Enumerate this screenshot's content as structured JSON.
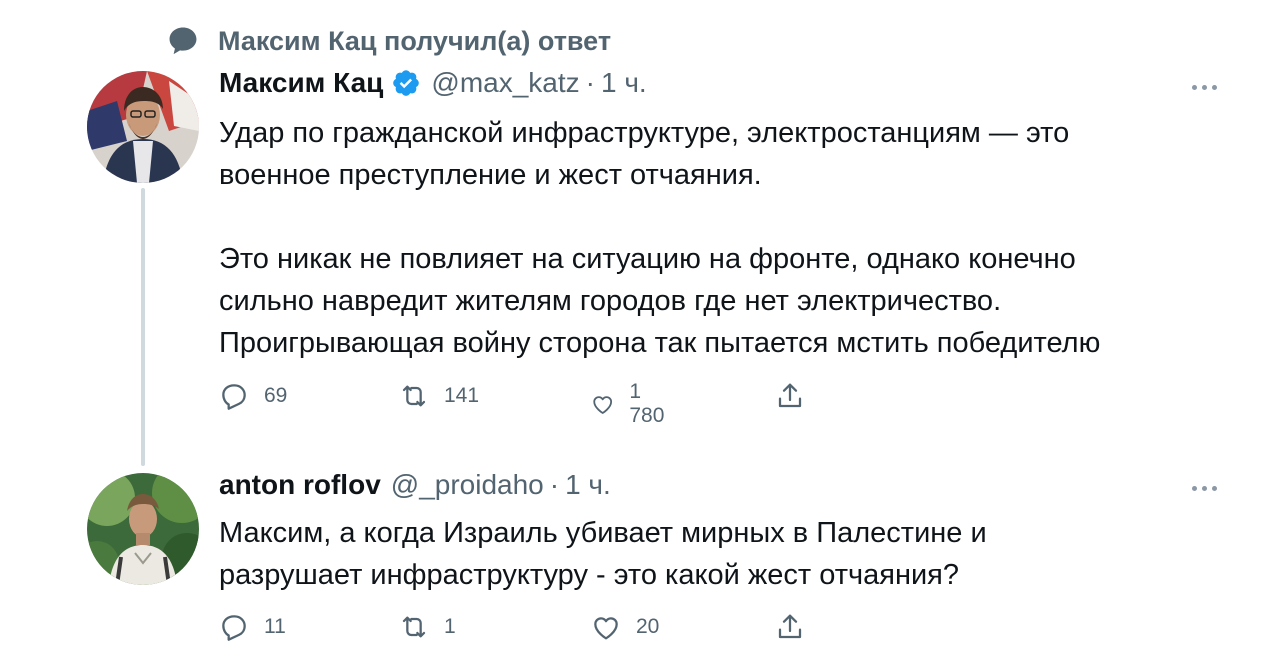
{
  "context": {
    "icon": "speech-bubble-icon",
    "text": "Максим Кац получил(а) ответ"
  },
  "tweets": [
    {
      "name": "Максим Кац",
      "verified": true,
      "handle": "@max_katz",
      "separator": "·",
      "time": "1 ч.",
      "text_lines": [
        "Удар по гражданской инфраструктуре, электростанциям — это",
        "военное преступление и жест отчаяния.",
        "Это никак не повлияет на ситуацию на фронте, однако конечно",
        "сильно навредит жителям городов где нет электричество.",
        "Проигрывающая войну сторона так пытается мстить победителю"
      ],
      "replies": "69",
      "retweets": "141",
      "likes": "1 780"
    },
    {
      "name": "anton roflov",
      "verified": false,
      "handle": "@_proidaho",
      "separator": "·",
      "time": "1 ч.",
      "text_lines": [
        "Максим, а когда Израиль убивает мирных в Палестине и",
        "разрушает инфраструктуру - это какой жест отчаяния?"
      ],
      "replies": "11",
      "retweets": "1",
      "likes": "20"
    }
  ],
  "colors": {
    "text": "#0f1419",
    "secondary": "#536471",
    "verified": "#1d9bf0",
    "thread_line": "#cfd9de"
  }
}
